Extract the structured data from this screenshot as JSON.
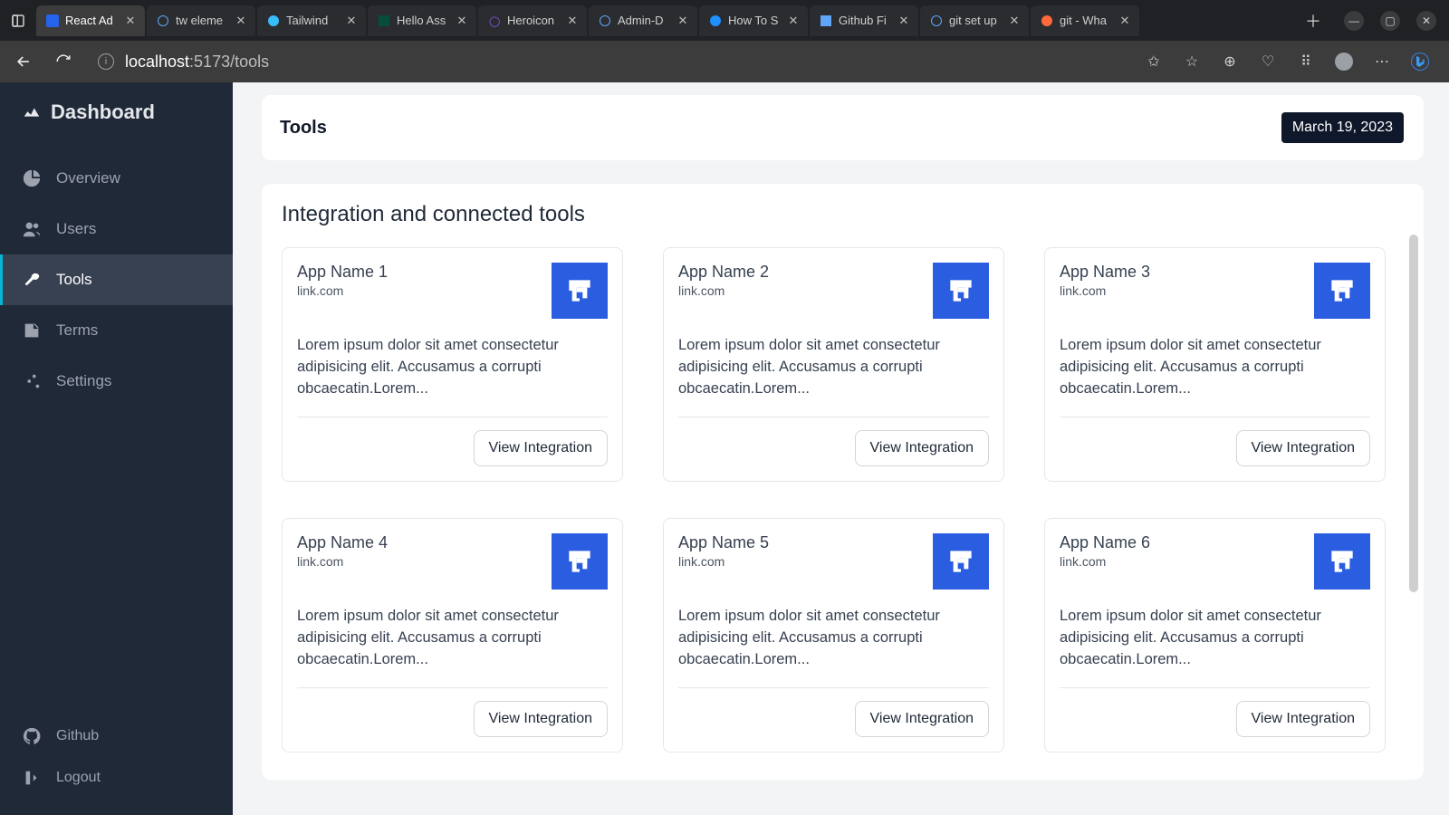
{
  "browser": {
    "tabs": [
      {
        "label": "React Ad",
        "active": true
      },
      {
        "label": "tw eleme"
      },
      {
        "label": "Tailwind"
      },
      {
        "label": "Hello Ass"
      },
      {
        "label": "Heroicon"
      },
      {
        "label": "Admin-D"
      },
      {
        "label": "How To S"
      },
      {
        "label": "Github Fi"
      },
      {
        "label": "git set up"
      },
      {
        "label": "git - Wha"
      }
    ],
    "url_host": "localhost",
    "url_port_path": ":5173/tools"
  },
  "sidebar": {
    "brand": "Dashboard",
    "items": [
      {
        "label": "Overview"
      },
      {
        "label": "Users"
      },
      {
        "label": "Tools"
      },
      {
        "label": "Terms"
      },
      {
        "label": "Settings"
      }
    ],
    "bottom": [
      {
        "label": "Github"
      },
      {
        "label": "Logout"
      }
    ]
  },
  "header": {
    "title": "Tools",
    "date": "March 19, 2023"
  },
  "panel": {
    "title": "Integration and connected tools",
    "button_label": "View Integration",
    "cards": [
      {
        "name": "App Name 1",
        "link": "link.com",
        "desc": "Lorem ipsum dolor sit amet consectetur adipisicing elit. Accusamus a corrupti obcaecatin.Lorem..."
      },
      {
        "name": "App Name 2",
        "link": "link.com",
        "desc": "Lorem ipsum dolor sit amet consectetur adipisicing elit. Accusamus a corrupti obcaecatin.Lorem..."
      },
      {
        "name": "App Name 3",
        "link": "link.com",
        "desc": "Lorem ipsum dolor sit amet consectetur adipisicing elit. Accusamus a corrupti obcaecatin.Lorem..."
      },
      {
        "name": "App Name 4",
        "link": "link.com",
        "desc": "Lorem ipsum dolor sit amet consectetur adipisicing elit. Accusamus a corrupti obcaecatin.Lorem..."
      },
      {
        "name": "App Name 5",
        "link": "link.com",
        "desc": "Lorem ipsum dolor sit amet consectetur adipisicing elit. Accusamus a corrupti obcaecatin.Lorem..."
      },
      {
        "name": "App Name 6",
        "link": "link.com",
        "desc": "Lorem ipsum dolor sit amet consectetur adipisicing elit. Accusamus a corrupti obcaecatin.Lorem..."
      }
    ]
  }
}
